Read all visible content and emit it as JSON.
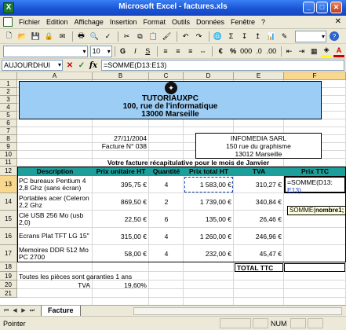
{
  "window": {
    "title": "Microsoft Excel - factures.xls",
    "app_icon_letter": "X"
  },
  "menu": [
    "Fichier",
    "Edition",
    "Affichage",
    "Insertion",
    "Format",
    "Outils",
    "Données",
    "Fenêtre",
    "?"
  ],
  "toolbar": {
    "font_size": "10",
    "currency": "€",
    "percent": "%"
  },
  "formula_bar": {
    "name_box": "AUJOURDHUI",
    "formula": "=SOMME(D13:E13)",
    "fx": "fx"
  },
  "columns": [
    "A",
    "B",
    "C",
    "D",
    "E",
    "F"
  ],
  "rows": [
    "1",
    "2",
    "3",
    "4",
    "5",
    "6",
    "7",
    "8",
    "9",
    "10",
    "11",
    "12",
    "13",
    "14",
    "15",
    "16",
    "17",
    "18",
    "19",
    "20",
    "21"
  ],
  "company": {
    "name": "TUTORIAUXPC",
    "address": "100, rue de l'informatique",
    "city": "13000 Marseille"
  },
  "invoice": {
    "date": "27/11/2004",
    "number": "Facture N° 038"
  },
  "client": {
    "name": "INFOMEDIA SARL",
    "address": "150 rue du graphisme",
    "city": "13012 Marseille"
  },
  "summary_title": "Votre facture récapitulative pour le mois de Janvier",
  "table": {
    "headers": [
      "Description",
      "Prix unitaire HT",
      "Quantité",
      "Prix total HT",
      "TVA",
      "Prix TTC"
    ],
    "rows": [
      {
        "description": "PC bureaux Pentium 4 2,8 Ghz (sans écran)",
        "unit_price": "395,75 €",
        "qty": "4",
        "total_ht": "1 583,00 €",
        "tva": "310,27 €",
        "ttc_formula": "=SOMME(D13:",
        "ttc_ref": "E13)"
      },
      {
        "description": "Portables acer (Celeron 2,2 Ghz",
        "unit_price": "869,50 €",
        "qty": "2",
        "total_ht": "1 739,00 €",
        "tva": "340,84 €",
        "ttc": ""
      },
      {
        "description": "Clé USB 256 Mo (usb 2,0)",
        "unit_price": "22,50 €",
        "qty": "6",
        "total_ht": "135,00 €",
        "tva": "26,46 €",
        "ttc": ""
      },
      {
        "description": "Ecrans Plat TFT LG 15\"",
        "unit_price": "315,00 €",
        "qty": "4",
        "total_ht": "1 260,00 €",
        "tva": "246,96 €",
        "ttc": ""
      },
      {
        "description": "Memoires DDR 512 Mo PC 2700",
        "unit_price": "58,00 €",
        "qty": "4",
        "total_ht": "232,00 €",
        "tva": "45,47 €",
        "ttc": ""
      }
    ],
    "total_label": "TOTAL TTC"
  },
  "footnote": "Toutes les pièces sont garanties 1 ans",
  "tva": {
    "label": "TVA",
    "rate": "19,60%"
  },
  "tooltip": {
    "func": "SOMME(",
    "arg": "nombre1;"
  },
  "sheet_tab": "Facture",
  "status": {
    "mode": "Pointer",
    "num": "NUM"
  }
}
